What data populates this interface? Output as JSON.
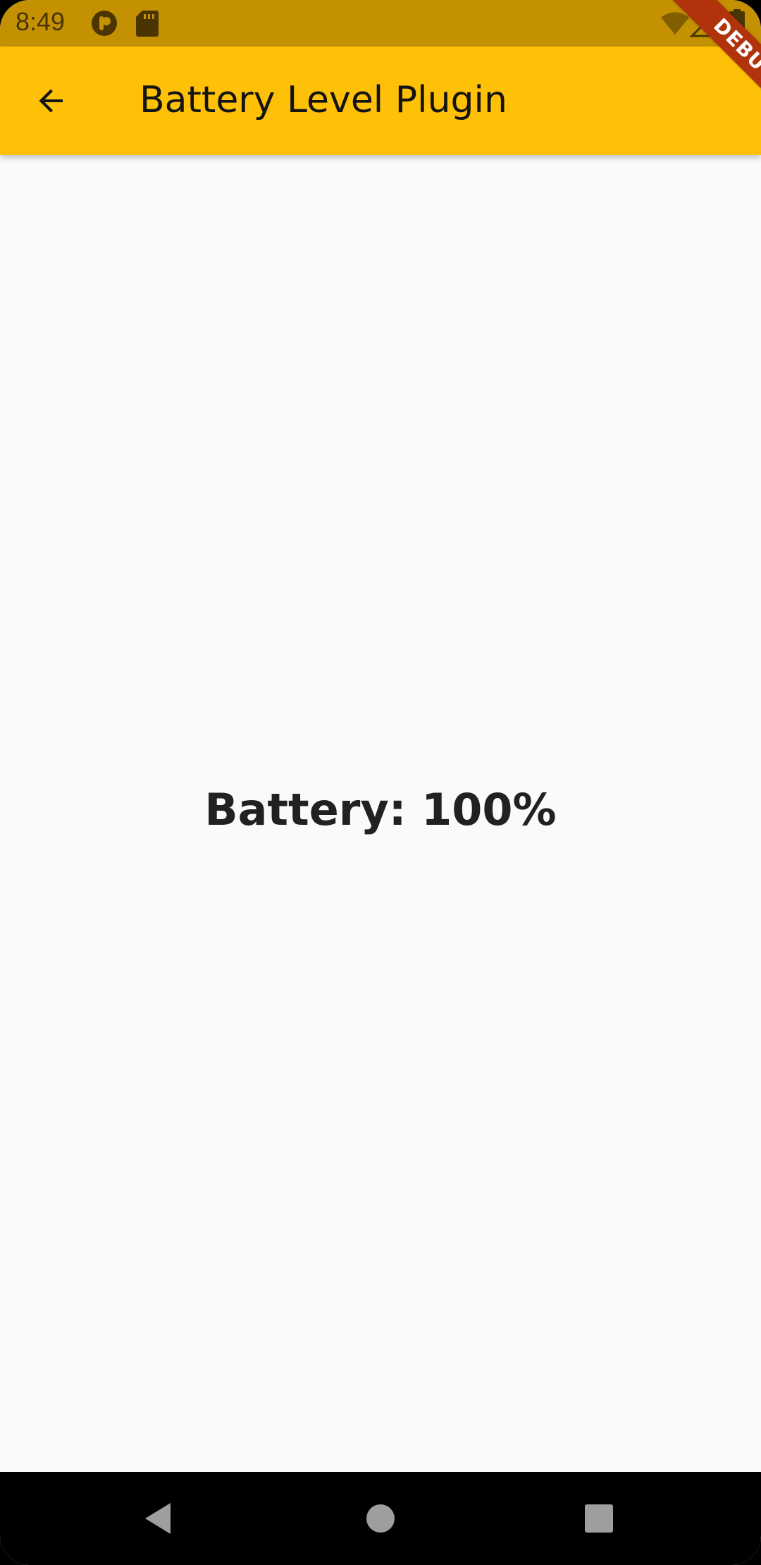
{
  "status_bar": {
    "time": "8:49",
    "icons": [
      "app-notification-icon",
      "sd-card-icon",
      "wifi-icon",
      "signal-icon",
      "battery-icon"
    ]
  },
  "app_bar": {
    "title": "Battery Level Plugin",
    "back_icon": "arrow-back-icon"
  },
  "main": {
    "battery_text": "Battery: 100%"
  },
  "debug_banner": {
    "label": "DEBUG"
  },
  "navigation": {
    "back": "nav-back-icon",
    "home": "nav-home-icon",
    "recents": "nav-recents-icon"
  },
  "colors": {
    "status_bar": "#c49102",
    "app_bar": "#ffc107",
    "background": "#fafafa",
    "text": "#212121",
    "debug_banner": "#b0330c"
  }
}
